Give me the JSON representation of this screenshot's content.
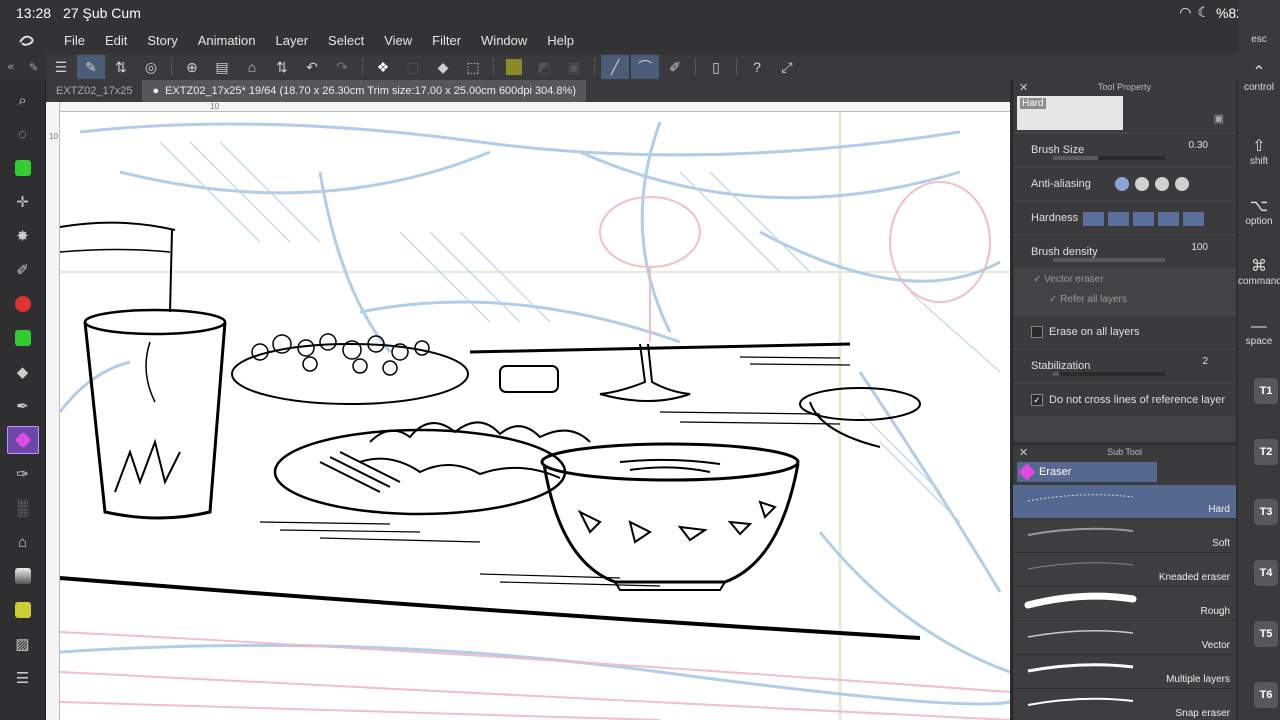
{
  "status_bar": {
    "time": "13:28",
    "date": "27 Şub Cum",
    "battery": "%82"
  },
  "menu": {
    "items": [
      "File",
      "Edit",
      "Story",
      "Animation",
      "Layer",
      "Select",
      "View",
      "Filter",
      "Window",
      "Help"
    ]
  },
  "tabs": [
    {
      "label": "EXTZ02_17x25"
    },
    {
      "label": "EXTZ02_17x25* 19/64 (18.70 x 26.30cm Trim size:17.00 x 25.00cm 600dpi 304.8%)"
    }
  ],
  "rulers": {
    "top_tick": "10",
    "left_tick": "10"
  },
  "tool_property": {
    "title": "Tool Property",
    "preset": "Hard",
    "brush_size": {
      "label": "Brush Size",
      "value": "0.30"
    },
    "anti_aliasing": {
      "label": "Anti-aliasing"
    },
    "hardness": {
      "label": "Hardness"
    },
    "brush_density": {
      "label": "Brush density",
      "value": "100"
    },
    "vector_eraser": {
      "label": "Vector eraser"
    },
    "refer_all_layers": {
      "label": "Refer all layers"
    },
    "erase_all_layers": {
      "label": "Erase on all layers"
    },
    "stabilization": {
      "label": "Stabilization",
      "value": "2"
    },
    "no_cross": {
      "label": "Do not cross lines of reference layer"
    }
  },
  "sub_tool": {
    "title": "Sub Tool",
    "group": "Eraser",
    "items": [
      "Hard",
      "Soft",
      "Kneaded eraser",
      "Rough",
      "Vector",
      "Multiple layers",
      "Snap eraser"
    ]
  },
  "keys": {
    "esc": "esc",
    "control": "control",
    "shift": "shift",
    "option": "option",
    "command": "command",
    "space": "space",
    "t": [
      "T1",
      "T2",
      "T3",
      "T4",
      "T5",
      "T6"
    ]
  }
}
